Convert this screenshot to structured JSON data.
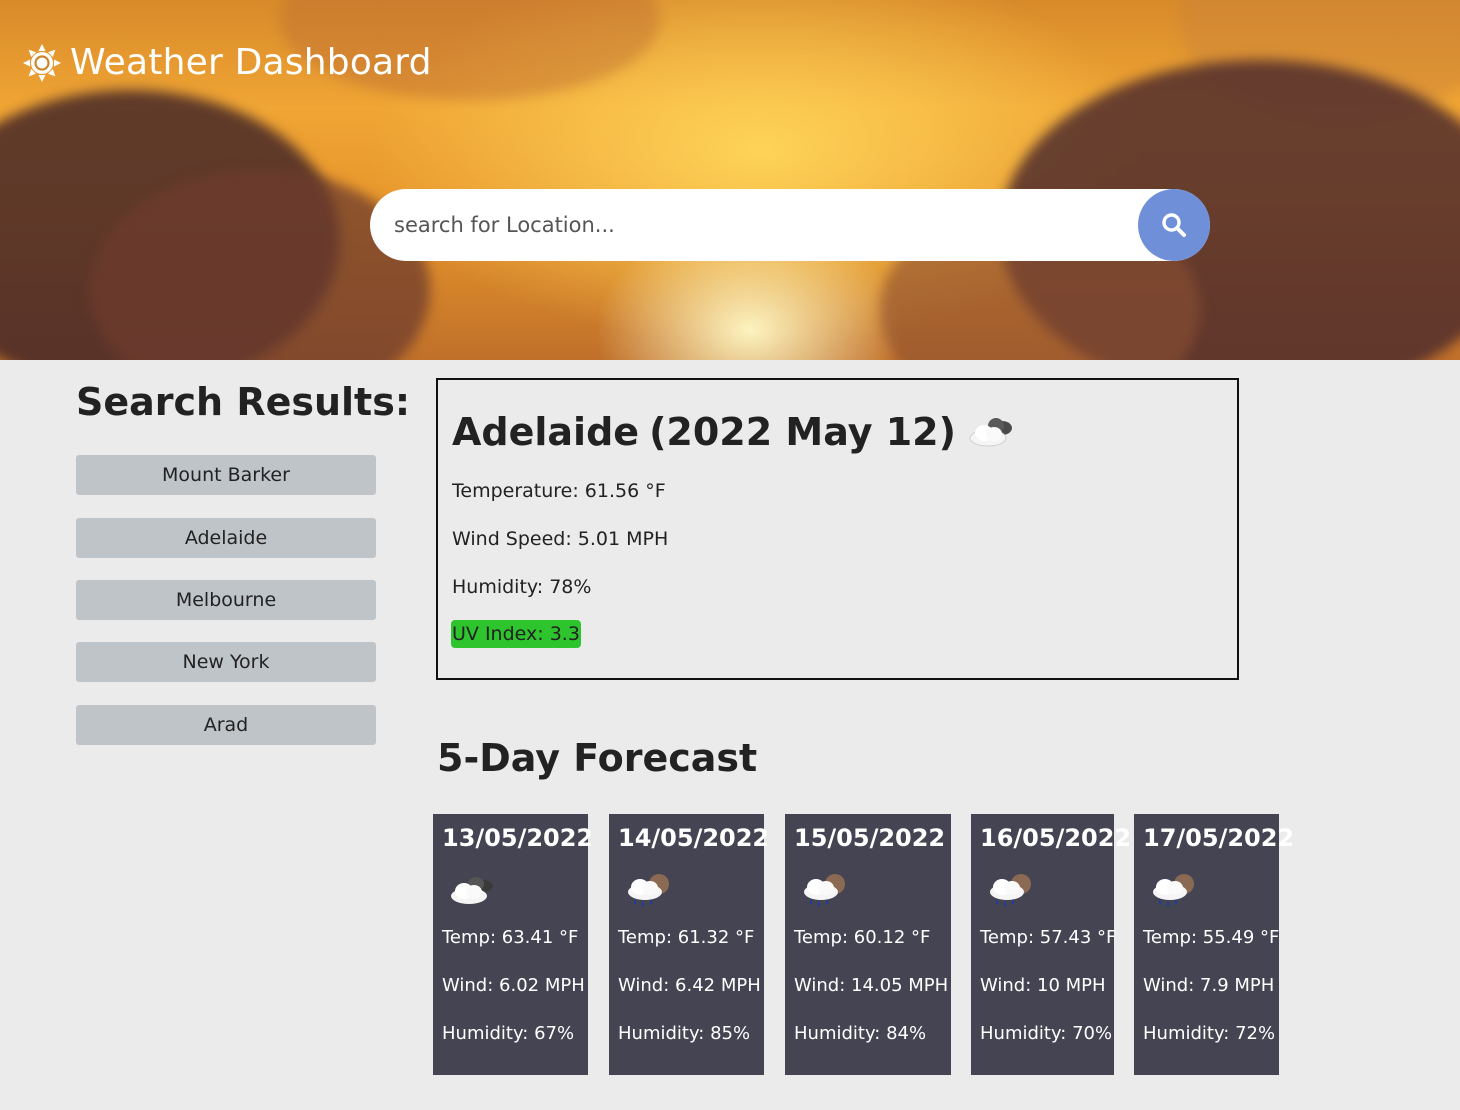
{
  "header": {
    "title": "Weather Dashboard",
    "icon": "sun-icon"
  },
  "search": {
    "placeholder": "search for Location...",
    "value": "",
    "button_icon": "search-icon",
    "button_color": "#6f8fd9"
  },
  "sidebar": {
    "title": "Search Results:",
    "items": [
      {
        "label": "Mount Barker"
      },
      {
        "label": "Adelaide"
      },
      {
        "label": "Melbourne"
      },
      {
        "label": "New York"
      },
      {
        "label": "Arad"
      }
    ]
  },
  "current": {
    "city": "Adelaide",
    "date": "(2022 May 12)",
    "icon": "cloudy-icon",
    "temperature": "Temperature: 61.56 °F",
    "wind": "Wind Speed: 5.01 MPH",
    "humidity": "Humidity: 78%",
    "uv": "UV Index: 3.3",
    "uv_color": "#2dc42d"
  },
  "forecast": {
    "title": "5-Day Forecast",
    "card_color": "#454452",
    "days": [
      {
        "date": "13/05/2022",
        "icon": "cloudy-icon",
        "temp": "Temp: 63.41 °F",
        "wind": "Wind: 6.02 MPH",
        "humidity": "Humidity: 67%"
      },
      {
        "date": "14/05/2022",
        "icon": "rain-icon",
        "temp": "Temp: 61.32 °F",
        "wind": "Wind: 6.42 MPH",
        "humidity": "Humidity: 85%"
      },
      {
        "date": "15/05/2022",
        "icon": "rain-icon",
        "temp": "Temp: 60.12 °F",
        "wind": "Wind: 14.05 MPH",
        "humidity": "Humidity: 84%"
      },
      {
        "date": "16/05/2022",
        "icon": "rain-icon",
        "temp": "Temp: 57.43 °F",
        "wind": "Wind: 10 MPH",
        "humidity": "Humidity: 70%"
      },
      {
        "date": "17/05/2022",
        "icon": "rain-icon",
        "temp": "Temp: 55.49 °F",
        "wind": "Wind: 7.9 MPH",
        "humidity": "Humidity: 72%"
      }
    ]
  }
}
